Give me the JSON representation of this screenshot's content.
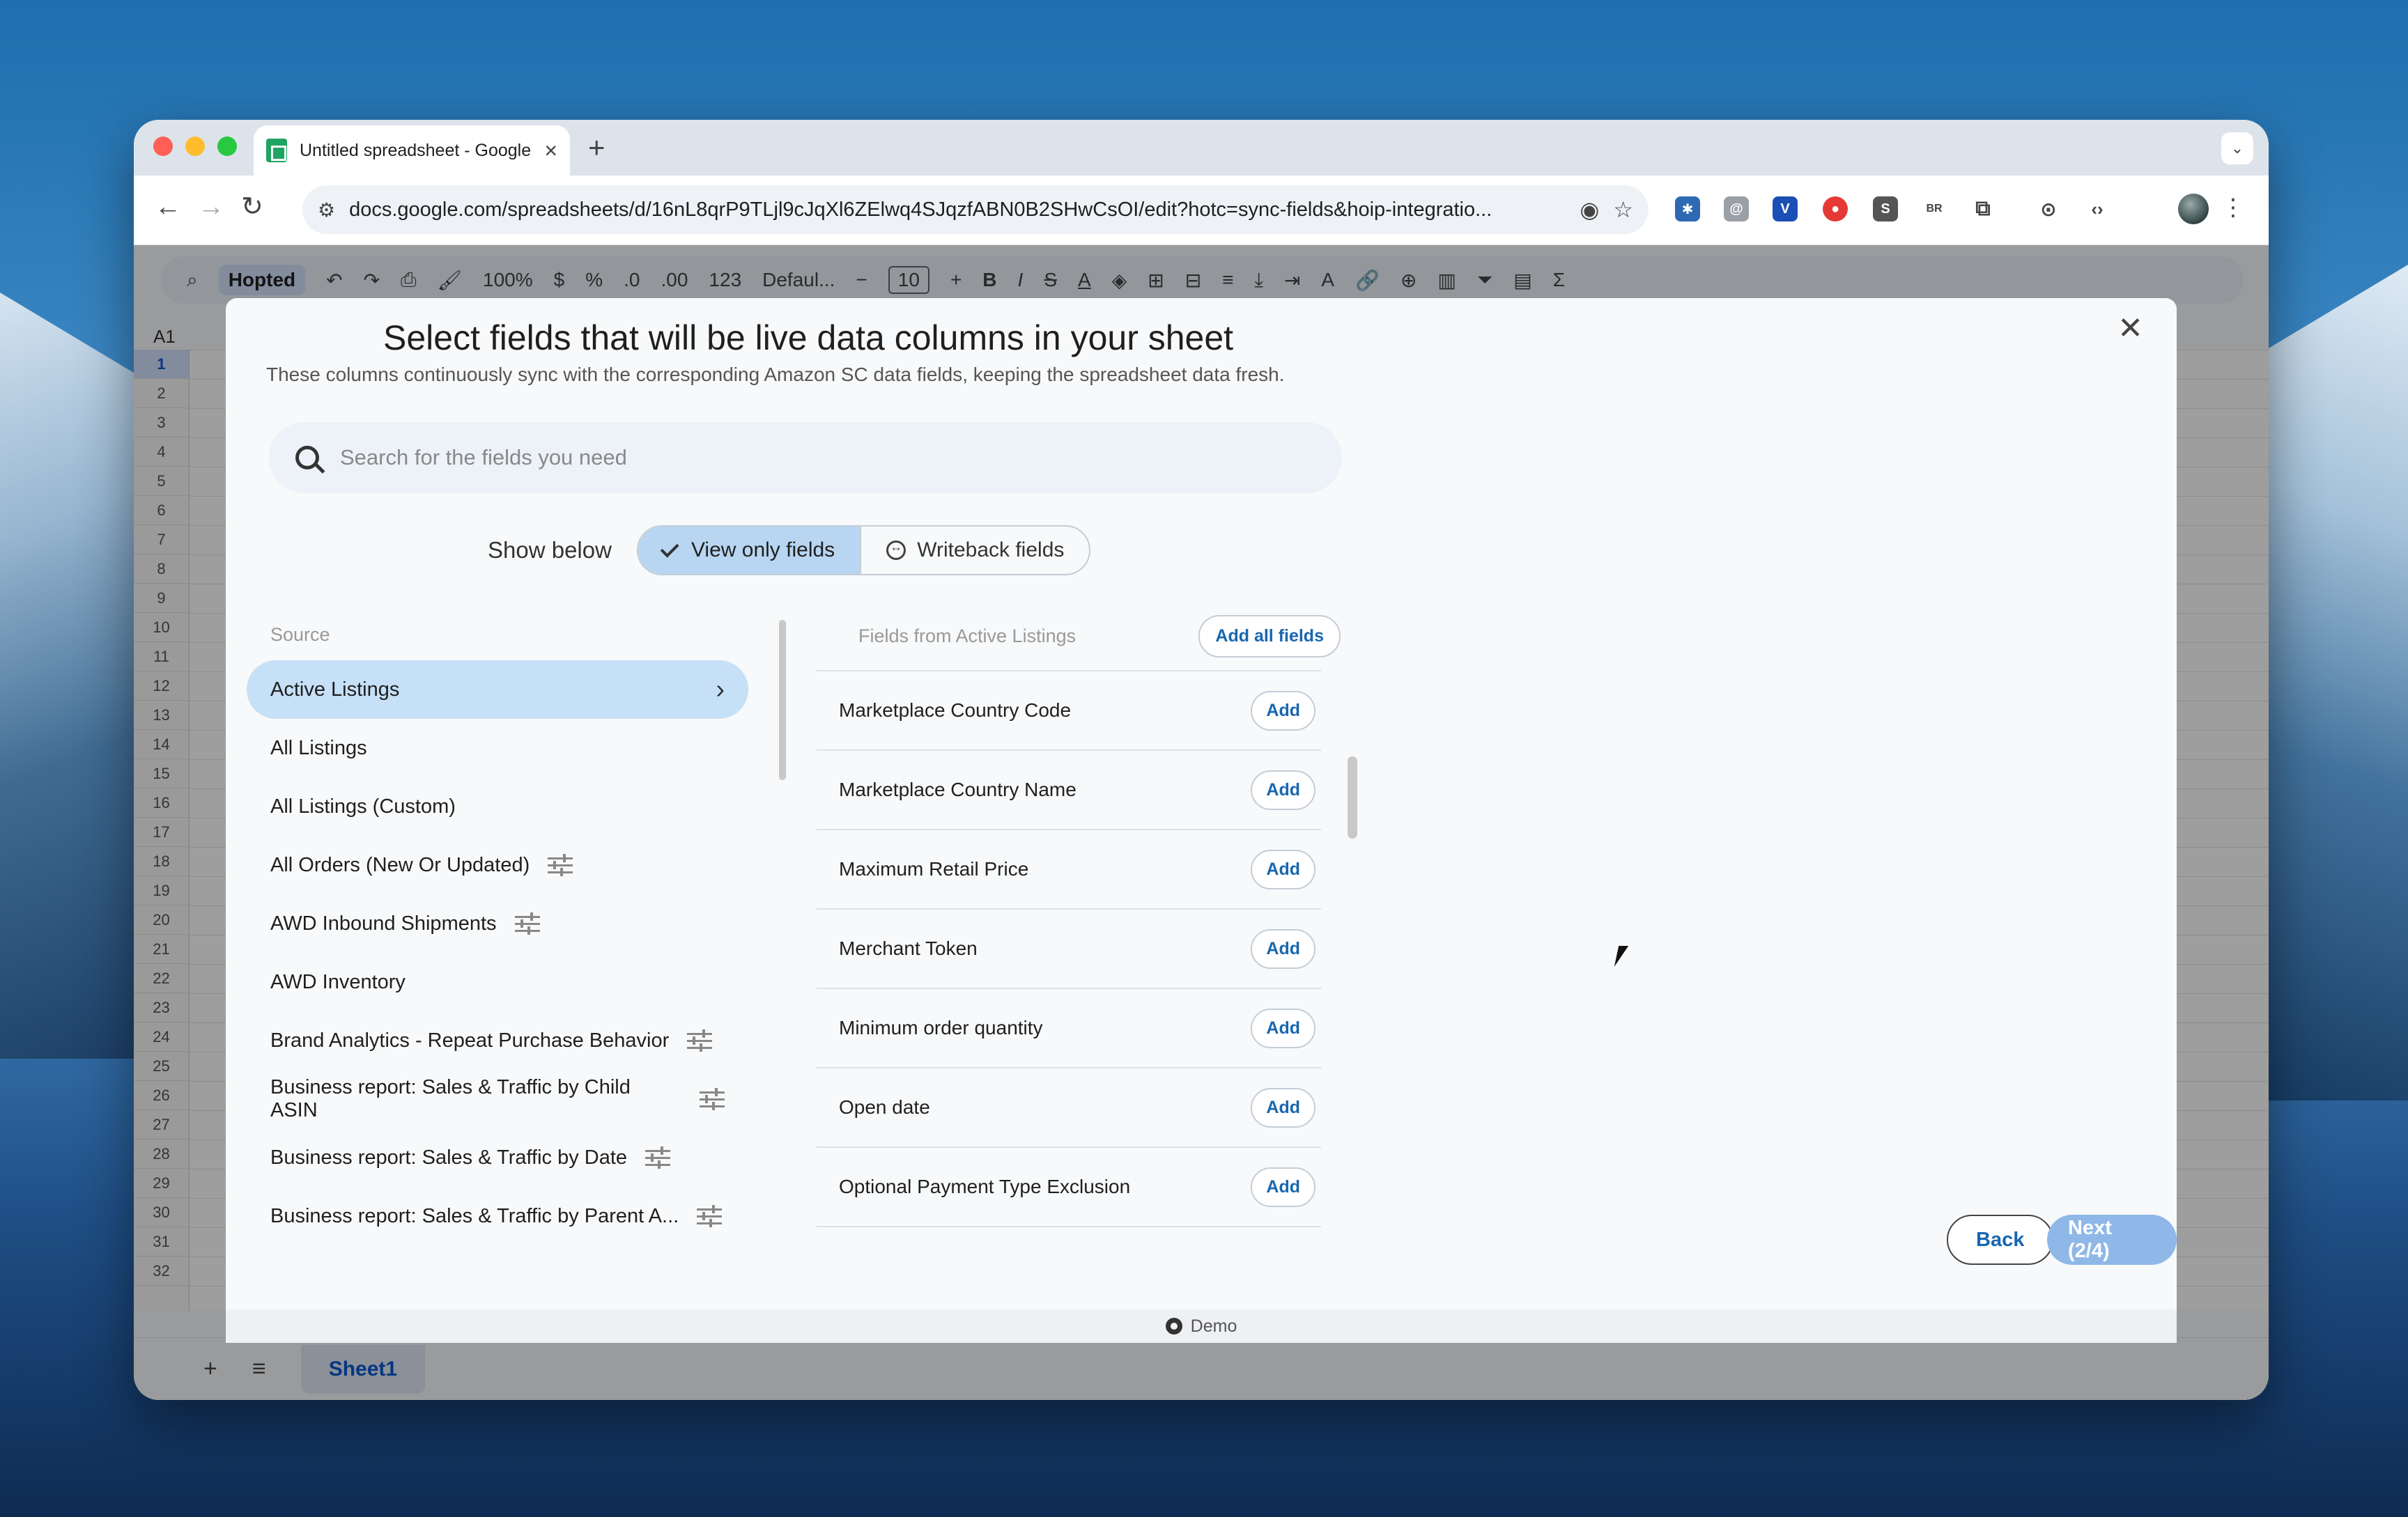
{
  "browser": {
    "tab_title": "Untitled spreadsheet - Google Sheets",
    "url": "docs.google.com/spreadsheets/d/16nL8qrP9TLjl9cJqXl6ZElwq4SJqzfABN0B2SHwCsOI/edit?hotc=sync-fields&hoip-integratio..."
  },
  "sheets": {
    "brand_chip": "Hopted",
    "zoom": "100%",
    "font": "Defaul...",
    "font_size": "10",
    "name_box": "A1",
    "rows": [
      "1",
      "2",
      "3",
      "4",
      "5",
      "6",
      "7",
      "8",
      "9",
      "10",
      "11",
      "12",
      "13",
      "14",
      "15",
      "16",
      "17",
      "18",
      "19",
      "20",
      "21",
      "22",
      "23",
      "24",
      "25",
      "26",
      "27",
      "28",
      "29",
      "30",
      "31",
      "32"
    ],
    "sheet_tab": "Sheet1"
  },
  "dialog": {
    "title": "Select fields that will be live data columns in your sheet",
    "subtitle": "These columns continuously sync with the corresponding Amazon SC data fields, keeping the spreadsheet data fresh.",
    "search_placeholder": "Search for the fields you need",
    "show_below_label": "Show below",
    "toggle": {
      "view_only": "View only fields",
      "writeback": "Writeback fields"
    },
    "source_label": "Source",
    "sources": [
      {
        "label": "Active Listings",
        "active": true,
        "filter": false
      },
      {
        "label": "All Listings",
        "active": false,
        "filter": false
      },
      {
        "label": "All Listings (Custom)",
        "active": false,
        "filter": false
      },
      {
        "label": "All Orders (New Or Updated)",
        "active": false,
        "filter": true
      },
      {
        "label": "AWD Inbound Shipments",
        "active": false,
        "filter": true
      },
      {
        "label": "AWD Inventory",
        "active": false,
        "filter": false
      },
      {
        "label": "Brand Analytics - Repeat Purchase Behavior",
        "active": false,
        "filter": true
      },
      {
        "label": "Business report: Sales & Traffic by Child ASIN",
        "active": false,
        "filter": true
      },
      {
        "label": "Business report: Sales & Traffic by Date",
        "active": false,
        "filter": true
      },
      {
        "label": "Business report: Sales & Traffic by Parent A...",
        "active": false,
        "filter": true
      }
    ],
    "fields_header": "Fields from Active Listings",
    "add_all_label": "Add all fields",
    "add_label": "Add",
    "fields": [
      "Marketplace Country Code",
      "Marketplace Country Name",
      "Maximum Retail Price",
      "Merchant Token",
      "Minimum order quantity",
      "Open date",
      "Optional Payment Type Exclusion"
    ],
    "back_label": "Back",
    "next_label": "Next (2/4)",
    "footer_label": "Demo"
  }
}
